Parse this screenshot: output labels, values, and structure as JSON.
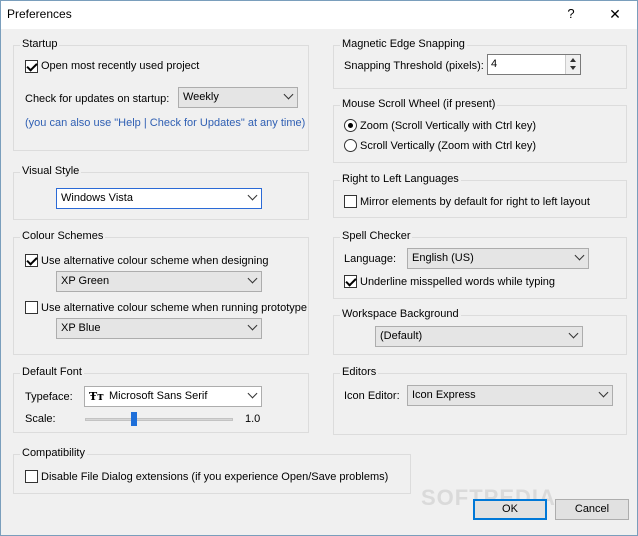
{
  "window": {
    "title": "Preferences",
    "help_glyph": "?",
    "close_glyph": "✕"
  },
  "startup": {
    "legend": "Startup",
    "open_recent": {
      "label": "Open most recently used project",
      "checked": true
    },
    "updates_label": "Check for updates on startup:",
    "updates_value": "Weekly",
    "hint": "(you can also use \"Help | Check for Updates\" at any time)"
  },
  "visual_style": {
    "legend": "Visual Style",
    "value": "Windows Vista"
  },
  "colour_schemes": {
    "legend": "Colour Schemes",
    "designing": {
      "label": "Use alternative colour scheme when designing",
      "checked": true,
      "value": "XP Green"
    },
    "prototype": {
      "label": "Use alternative colour scheme when running prototype",
      "checked": false,
      "value": "XP Blue"
    }
  },
  "default_font": {
    "legend": "Default Font",
    "typeface_label": "Typeface:",
    "typeface_value": "Microsoft Sans Serif",
    "font_icon": "Ŧт",
    "scale_label": "Scale:",
    "scale_value": "1.0",
    "scale_fraction": 0.33
  },
  "compatibility": {
    "legend": "Compatibility",
    "disable_dialog": {
      "label": "Disable File Dialog extensions (if you experience Open/Save problems)",
      "checked": false
    }
  },
  "magnetic": {
    "legend": "Magnetic Edge Snapping",
    "threshold_label": "Snapping Threshold (pixels):",
    "threshold_value": "4"
  },
  "mouse_scroll": {
    "legend": "Mouse Scroll Wheel (if present)",
    "zoom": {
      "label": "Zoom (Scroll Vertically with Ctrl key)",
      "checked": true
    },
    "scroll": {
      "label": "Scroll Vertically (Zoom with Ctrl key)",
      "checked": false
    }
  },
  "rtl": {
    "legend": "Right to Left Languages",
    "mirror": {
      "label": "Mirror elements by default for right to left layout",
      "checked": false
    }
  },
  "spell": {
    "legend": "Spell Checker",
    "language_label": "Language:",
    "language_value": "English (US)",
    "underline": {
      "label": "Underline misspelled words while typing",
      "checked": true
    }
  },
  "workspace": {
    "legend": "Workspace Background",
    "value": "(Default)"
  },
  "editors": {
    "legend": "Editors",
    "icon_editor_label": "Icon Editor:",
    "icon_editor_value": "Icon Express"
  },
  "buttons": {
    "ok": "OK",
    "cancel": "Cancel"
  },
  "watermark": "SOFTPEDIA"
}
